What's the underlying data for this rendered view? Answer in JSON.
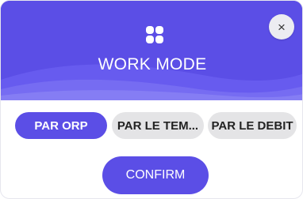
{
  "dialog": {
    "title": "WORK MODE",
    "close_label": "×",
    "accent_color": "#5b4ee6",
    "mode_icon": "four-petal-grid-icon"
  },
  "options": [
    {
      "label": "PAR ORP",
      "selected": true
    },
    {
      "label": "PAR LE TEM...",
      "selected": false
    },
    {
      "label": "PAR LE DEBIT",
      "selected": false
    }
  ],
  "confirm": {
    "label": "CONFIRM"
  }
}
